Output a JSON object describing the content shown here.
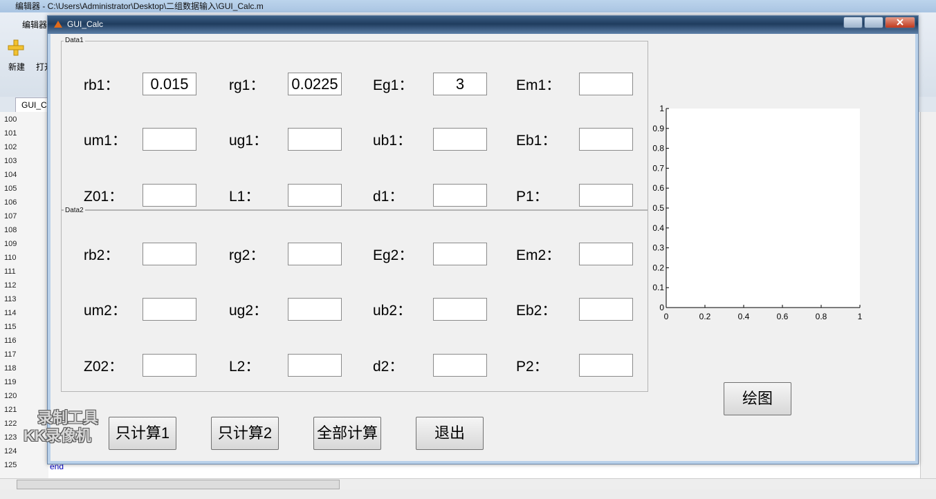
{
  "editor": {
    "title": "编辑器 - C:\\Users\\Administrator\\Desktop\\二组数据输入\\GUI_Calc.m",
    "tab_label": "编辑器",
    "new_label": "新建",
    "open_label": "打开",
    "file_tab": "GUI_C",
    "line_numbers": [
      "100",
      "101",
      "102",
      "103",
      "104",
      "105",
      "106",
      "107",
      "108",
      "109",
      "110",
      "111",
      "112",
      "113",
      "114",
      "115",
      "116",
      "117",
      "118",
      "119",
      "120",
      "121",
      "122",
      "123",
      "124",
      "125"
    ],
    "code_end": "end"
  },
  "window": {
    "title": "GUI_Calc"
  },
  "panels": {
    "data1_title": "Data1",
    "data2_title": "Data2"
  },
  "data1": {
    "rows": [
      [
        {
          "label": "rb1：",
          "value": "0.015"
        },
        {
          "label": "rg1：",
          "value": "0.0225"
        },
        {
          "label": "Eg1：",
          "value": "3"
        },
        {
          "label": "Em1：",
          "value": ""
        }
      ],
      [
        {
          "label": "um1：",
          "value": ""
        },
        {
          "label": "ug1：",
          "value": ""
        },
        {
          "label": "ub1：",
          "value": ""
        },
        {
          "label": "Eb1：",
          "value": ""
        }
      ],
      [
        {
          "label": "Z01：",
          "value": ""
        },
        {
          "label": "L1：",
          "value": ""
        },
        {
          "label": "d1：",
          "value": ""
        },
        {
          "label": "P1：",
          "value": ""
        }
      ]
    ]
  },
  "data2": {
    "rows": [
      [
        {
          "label": "rb2：",
          "value": ""
        },
        {
          "label": "rg2：",
          "value": ""
        },
        {
          "label": "Eg2：",
          "value": ""
        },
        {
          "label": "Em2：",
          "value": ""
        }
      ],
      [
        {
          "label": "um2：",
          "value": ""
        },
        {
          "label": "ug2：",
          "value": ""
        },
        {
          "label": "ub2：",
          "value": ""
        },
        {
          "label": "Eb2：",
          "value": ""
        }
      ],
      [
        {
          "label": "Z02：",
          "value": ""
        },
        {
          "label": "L2：",
          "value": ""
        },
        {
          "label": "d2：",
          "value": ""
        },
        {
          "label": "P2：",
          "value": ""
        }
      ]
    ]
  },
  "buttons": {
    "calc1": "只计算1",
    "calc2": "只计算2",
    "calc_all": "全部计算",
    "exit": "退出",
    "plot": "绘图"
  },
  "chart_data": {
    "type": "line",
    "series": [],
    "xlim": [
      0,
      1
    ],
    "ylim": [
      0,
      1
    ],
    "xticks": [
      "0",
      "0.2",
      "0.4",
      "0.6",
      "0.8",
      "1"
    ],
    "yticks": [
      "0",
      "0.1",
      "0.2",
      "0.3",
      "0.4",
      "0.5",
      "0.6",
      "0.7",
      "0.8",
      "0.9",
      "1"
    ],
    "grid": false
  },
  "watermark": [
    "录制工具",
    "KK录像机"
  ]
}
